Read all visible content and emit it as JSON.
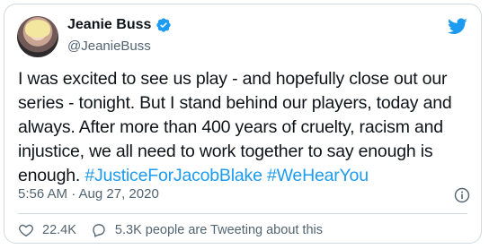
{
  "author": {
    "name": "Jeanie Buss",
    "handle": "@JeanieBuss"
  },
  "tweet": {
    "text": "I was excited to see us play - and hopefully close out our series - tonight. But I stand behind our players, today and always. After more than 400 years of cruelty, racism and injustice, we all need to work together to say enough is enough. ",
    "hashtags": [
      "#JusticeForJacobBlake",
      "#WeHearYou"
    ],
    "timestamp": "5:56 AM · Aug 27, 2020"
  },
  "actions": {
    "likes": "22.4K",
    "replies_text": "5.3K people are Tweeting about this"
  },
  "icons": {
    "verified": "verified-badge-icon",
    "brand": "twitter-bird-icon",
    "info": "info-icon",
    "like": "heart-icon",
    "reply": "comment-bubble-icon"
  },
  "colors": {
    "accent": "#1d9bf0",
    "text": "#0f1419",
    "muted": "#536471",
    "border": "#cfd9de"
  }
}
